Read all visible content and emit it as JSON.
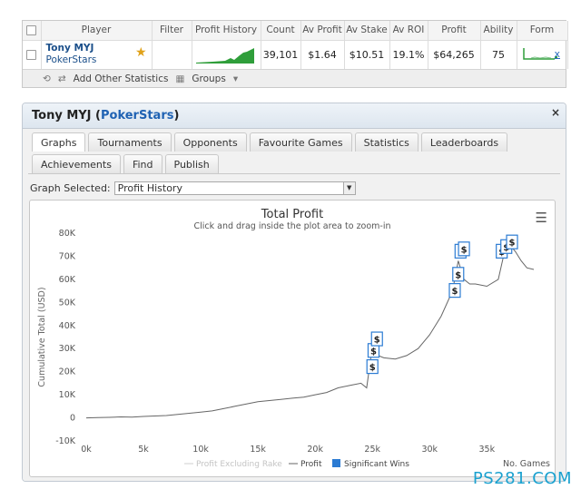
{
  "table": {
    "headers": [
      "Player",
      "Filter",
      "Profit History",
      "Count",
      "Av Profit",
      "Av Stake",
      "Av ROI",
      "Profit",
      "Ability",
      "Form"
    ],
    "row": {
      "player_name": "Tony MYJ",
      "site": "PokerStars",
      "filter": "",
      "count": "39,101",
      "av_profit": "$1.64",
      "av_stake": "$10.51",
      "av_roi": "19.1%",
      "profit": "$64,265",
      "ability": "75",
      "remove": "x"
    },
    "footer": {
      "add_stats": "Add Other Statistics",
      "groups": "Groups"
    }
  },
  "panel": {
    "title_name": "Tony MYJ (",
    "title_site": "PokerStars",
    "title_close_paren": ")",
    "close": "×",
    "tabs_row1": [
      "Graphs",
      "Tournaments",
      "Opponents",
      "Favourite Games",
      "Statistics",
      "Leaderboards"
    ],
    "tabs_row2": [
      "Achievements",
      "Find",
      "Publish"
    ],
    "graph_label": "Graph Selected:",
    "graph_value": "Profit History"
  },
  "chart_data": {
    "type": "line",
    "title": "Total Profit",
    "subtitle": "Click and drag inside the plot area to zoom-in",
    "ylabel": "Cumulative Total (USD)",
    "xlabel": "No. Games",
    "xlim": [
      0,
      39101
    ],
    "ylim": [
      -10000,
      80000
    ],
    "x_ticks": [
      "0k",
      "5k",
      "10k",
      "15k",
      "20k",
      "25k",
      "30k",
      "35k"
    ],
    "y_ticks": [
      "-10K",
      "0",
      "10K",
      "20K",
      "30K",
      "40K",
      "50K",
      "60K",
      "70K",
      "80K"
    ],
    "legend": [
      "Profit Excluding Rake",
      "Profit",
      "Significant Wins"
    ],
    "colors": {
      "profit": "#666666",
      "excluding_rake": "#cfcfcf",
      "significant": "#2b7bd3"
    },
    "series": [
      {
        "name": "Profit",
        "x": [
          0,
          1000,
          2000,
          3000,
          4000,
          5000,
          6000,
          7000,
          8000,
          9000,
          10000,
          11000,
          12000,
          13000,
          14000,
          15000,
          16000,
          17000,
          18000,
          19000,
          20000,
          21000,
          22000,
          23000,
          24000,
          24500,
          25000,
          25500,
          26000,
          27000,
          28000,
          29000,
          30000,
          31000,
          32000,
          32500,
          33000,
          33500,
          34000,
          35000,
          36000,
          36500,
          37000,
          37500,
          38000,
          38500,
          39101
        ],
        "values": [
          0,
          100,
          200,
          400,
          300,
          600,
          800,
          1000,
          1500,
          2000,
          2500,
          3000,
          4000,
          5000,
          6000,
          7000,
          7500,
          8000,
          8500,
          9000,
          10000,
          11000,
          13000,
          14000,
          15000,
          13000,
          31000,
          27000,
          26000,
          25500,
          27000,
          30000,
          36000,
          44000,
          55000,
          68000,
          60000,
          58000,
          58000,
          57000,
          60000,
          71000,
          75000,
          72000,
          68000,
          65000,
          64265
        ]
      }
    ],
    "significant_wins": [
      {
        "x": 25000,
        "y": 22000
      },
      {
        "x": 25100,
        "y": 29000
      },
      {
        "x": 25400,
        "y": 34000
      },
      {
        "x": 32200,
        "y": 55000
      },
      {
        "x": 32500,
        "y": 62000
      },
      {
        "x": 32700,
        "y": 72000
      },
      {
        "x": 33000,
        "y": 73000
      },
      {
        "x": 36300,
        "y": 72000
      },
      {
        "x": 36700,
        "y": 74000
      },
      {
        "x": 37200,
        "y": 76000
      }
    ]
  },
  "watermark": "PS281.COM"
}
